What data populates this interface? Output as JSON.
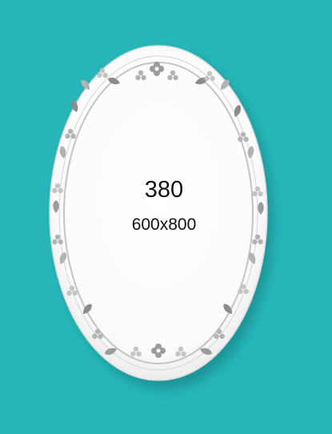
{
  "colors": {
    "background": "#27b5b7",
    "mirror": "#ffffff",
    "ornament": "#b3b3b3",
    "ornament_dark": "#8c8c8c",
    "text": "#111111"
  },
  "product": {
    "model": "380",
    "size": "600x800"
  }
}
